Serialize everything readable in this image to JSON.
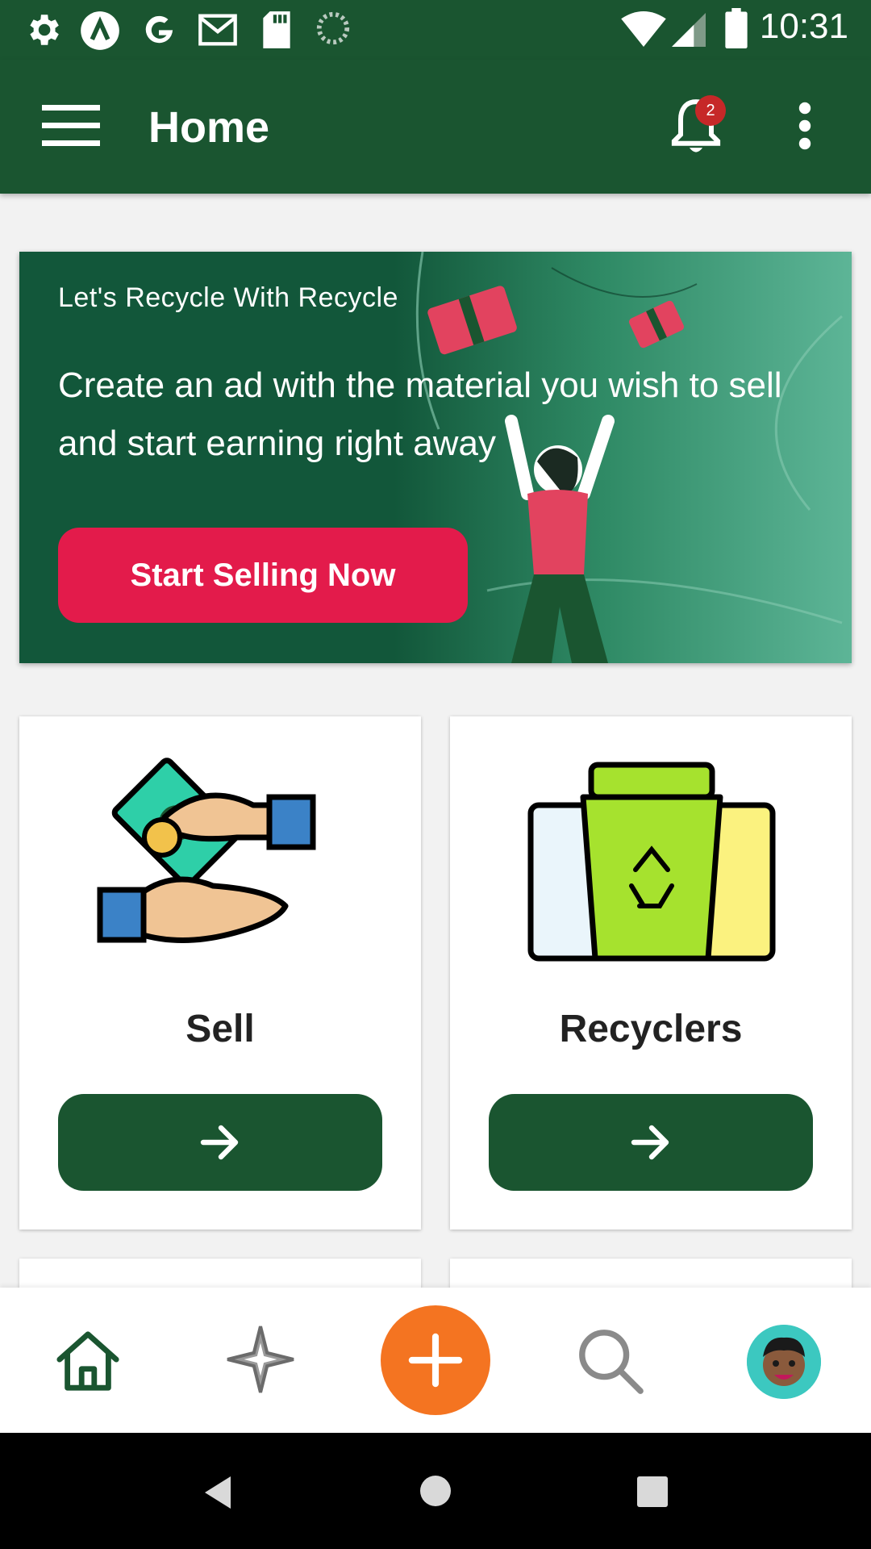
{
  "status_bar": {
    "time": "10:31",
    "icons": [
      "settings-icon",
      "app-a-icon",
      "google-icon",
      "gmail-icon",
      "sd-card-icon",
      "loading-icon",
      "wifi-icon",
      "cell-signal-icon",
      "battery-icon"
    ]
  },
  "app_bar": {
    "title": "Home",
    "notification_count": "2",
    "icons": [
      "menu-icon",
      "bell-icon",
      "more-vert-icon"
    ]
  },
  "banner": {
    "eyebrow": "Let's Recycle With Recycle",
    "headline": "Create an ad with the material you wish to sell and start earning right away",
    "cta_label": "Start Selling Now"
  },
  "cards": [
    {
      "label": "Sell",
      "icon": "cash-hands-icon"
    },
    {
      "label": "Recyclers",
      "icon": "recycle-bins-icon"
    }
  ],
  "bottom_nav": {
    "items": [
      "home-icon",
      "explore-icon",
      "add-icon",
      "search-icon",
      "avatar"
    ]
  },
  "colors": {
    "primary": "#1a5530",
    "accent_red": "#e31b4b",
    "accent_orange": "#f47421"
  }
}
